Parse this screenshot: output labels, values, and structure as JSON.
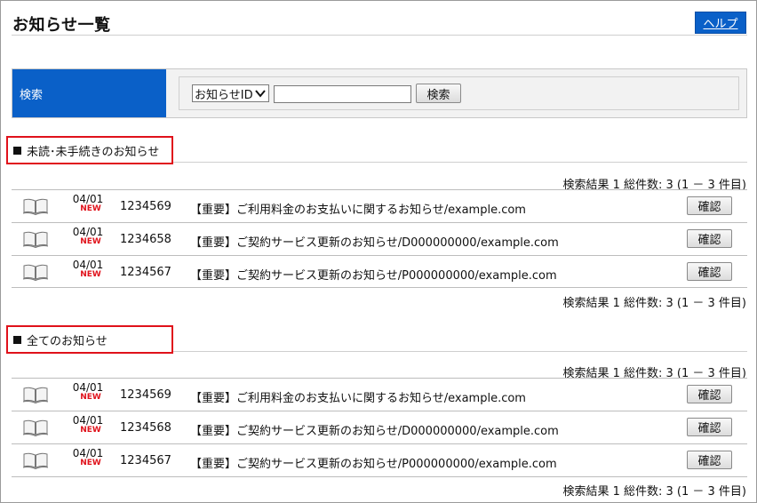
{
  "header": {
    "title": "お知らせ一覧",
    "help_label": "ヘルプ"
  },
  "search": {
    "label": "検索",
    "select_value": "お知らせID",
    "input_value": "",
    "button_label": "検索"
  },
  "sections": [
    {
      "heading": "未読･未手続きのお知らせ",
      "result_top": "検索結果 1 総件数: 3 (1 － 3 件目)",
      "result_bottom": "検索結果 1 総件数: 3 (1 － 3 件目)",
      "rows": [
        {
          "date": "04/01",
          "badge": "NEW",
          "id": "1234569",
          "title": "【重要】ご利用料金のお支払いに関するお知らせ/example.com",
          "button": "確認"
        },
        {
          "date": "04/01",
          "badge": "NEW",
          "id": "1234658",
          "title": "【重要】ご契約サービス更新のお知らせ/D000000000/example.com",
          "button": "確認"
        },
        {
          "date": "04/01",
          "badge": "NEW",
          "id": "1234567",
          "title": "【重要】ご契約サービス更新のお知らせ/P000000000/example.com",
          "button": "確認"
        }
      ]
    },
    {
      "heading": "全てのお知らせ",
      "result_top": "検索結果 1 総件数: 3 (1 － 3 件目)",
      "result_bottom": "検索結果 1 総件数: 3 (1 － 3 件目)",
      "rows": [
        {
          "date": "04/01",
          "badge": "NEW",
          "id": "1234569",
          "title": "【重要】ご利用料金のお支払いに関するお知らせ/example.com",
          "button": "確認"
        },
        {
          "date": "04/01",
          "badge": "NEW",
          "id": "1234568",
          "title": "【重要】ご契約サービス更新のお知らせ/D000000000/example.com",
          "button": "確認"
        },
        {
          "date": "04/01",
          "badge": "NEW",
          "id": "1234567",
          "title": "【重要】ご契約サービス更新のお知らせ/P000000000/example.com",
          "button": "確認"
        }
      ]
    }
  ],
  "icons": {
    "row_icon": "open-book-icon",
    "select_icon": "chevron-down-icon"
  },
  "colors": {
    "accent_blue": "#0a60c8",
    "highlight_red": "#e0121b",
    "new_badge": "#e0121b"
  }
}
